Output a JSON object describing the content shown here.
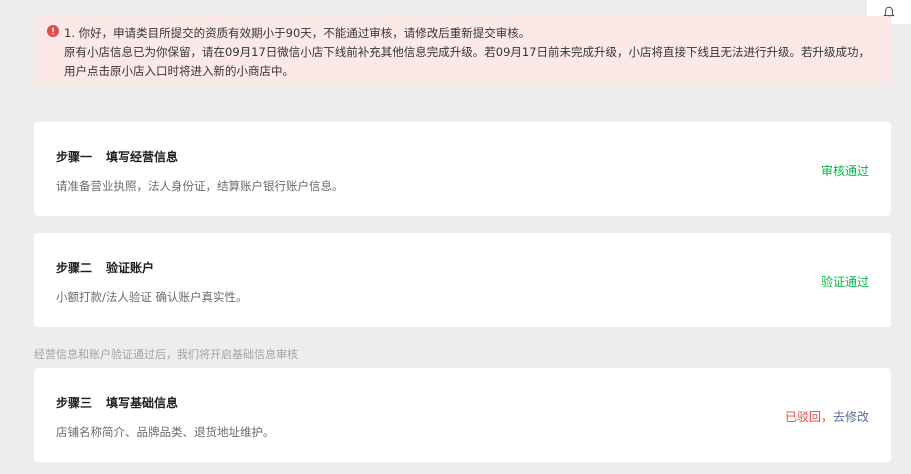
{
  "notice": {
    "line1": "1. 你好，申请类目所提交的资质有效期小于90天，不能通过审核，请修改后重新提交审核。",
    "line2": "原有小店信息已为你保留，请在09月17日微信小店下线前补充其他信息完成升级。若09月17日前未完成升级，小店将直接下线且无法进行升级。若升级成功，用户点击原小店入口时将进入新的小商店中。",
    "colors": {
      "background": "#fbe9e8",
      "icon": "#e24b4b"
    }
  },
  "steps": [
    {
      "step": "步骤一",
      "name": "填写经营信息",
      "desc": "请准备营业执照，法人身份证，结算账户银行账户信息。",
      "status": "审核通过"
    },
    {
      "step": "步骤二",
      "name": "验证账户",
      "desc": "小额打款/法人验证 确认账户真实性。",
      "status": "验证通过"
    },
    {
      "step": "步骤三",
      "name": "填写基础信息",
      "desc": "店铺名称简介、品牌品类、退货地址维护。",
      "status_rejected": "已驳回，",
      "status_action": "去修改"
    }
  ],
  "hint": "经营信息和账户验证通过后，我们将开启基础信息审核",
  "icons": {
    "bell": "bell-icon",
    "warning": "warning-icon"
  },
  "colors": {
    "success": "#07b34a",
    "error": "#e24b4b",
    "link": "#576b95"
  }
}
